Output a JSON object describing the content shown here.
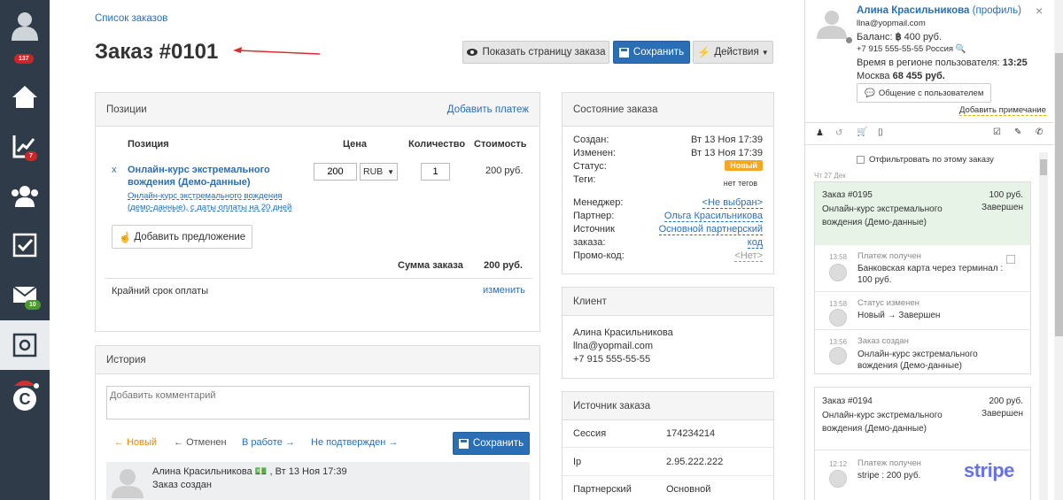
{
  "breadcrumb": "Список заказов",
  "page_title": "Заказ #0101",
  "toolbar": {
    "show_page": "Показать страницу заказа",
    "save": "Сохранить",
    "actions": "Действия"
  },
  "sidebar": {
    "badges": [
      "137",
      "7",
      "10"
    ]
  },
  "positions": {
    "title": "Позиции",
    "add_payment": "Добавить платеж",
    "headers": [
      "Позиция",
      "Цена",
      "Количество",
      "Стоимость"
    ],
    "remove": "x",
    "item_name": "Онлайн-курс экстремального вождения (Демо-данные)",
    "item_desc": "Онлайн-курс экстремального вождения (демо-данные), с даты оплаты на 20 дней",
    "price": "200",
    "currency": "RUB",
    "qty": "1",
    "cost": "200 руб.",
    "add_offer": "Добавить предложение",
    "sum_label": "Сумма заказа",
    "sum_value": "200 руб.",
    "deadline_label": "Крайний срок оплаты",
    "change": "изменить"
  },
  "history": {
    "title": "История",
    "placeholder": "Добавить комментарий",
    "statuses": [
      "Новый",
      "Отменен",
      "В работе",
      "Не подтвержден"
    ],
    "save": "Сохранить",
    "entry_author": "Алина Красильникова",
    "entry_time": ", Вт 13 Ноя 17:39",
    "entry_text": "Заказ создан"
  },
  "order_state": {
    "title": "Состояние заказа",
    "created_label": "Создан:",
    "created": "Вт 13 Ноя 17:39",
    "changed_label": "Изменен:",
    "changed": "Вт 13 Ноя 17:39",
    "status_label": "Статус:",
    "status": "Новый",
    "tags_label": "Теги:",
    "tags": "нет тегов",
    "manager_label": "Менеджер:",
    "manager": "<Не выбран>",
    "partner_label": "Партнер:",
    "partner": "Ольга Красильникова",
    "source_label": "Источник",
    "source": "Основной партнерский",
    "source_label2": "заказа:",
    "source2": "код",
    "promo_label": "Промо-код:",
    "promo": "<Нет>"
  },
  "client": {
    "title": "Клиент",
    "name": "Алина Красильникова",
    "email": "llna@yopmail.com",
    "phone": "+7 915 555-55-55"
  },
  "order_source": {
    "title": "Источник заказа",
    "session_label": "Сессия",
    "session": "174234214",
    "ip_label": "Ip",
    "ip": "2.95.222.222",
    "partner_label": "Партнерский",
    "partner": "Основной"
  },
  "user": {
    "name": "Алина Красильникова",
    "profile": "(профиль)",
    "email": "llna@yopmail.com",
    "balance_label": "Баланс:",
    "balance": "400 руб.",
    "phone": "+7 915 555-55-55 Россия",
    "region_time_label": "Время в регионе пользователя:",
    "region_time": "13:25",
    "moscow_label": "Москва",
    "moscow": "68 455 руб.",
    "chat_button": "Общение с пользователем",
    "add_note": "Добавить примечание"
  },
  "feed": {
    "filter": "Отфильтровать по этому заказу",
    "date": "Чт 27 Дек",
    "order1": {
      "id": "Заказ #0195",
      "price": "100 руб.",
      "name": "Онлайн-курс экстремального вождения (Демо-данные)",
      "status": "Завершен"
    },
    "events1": [
      {
        "time": "13:58",
        "title": "Платеж получен",
        "text": "Банковская карта через терминал : 100 руб."
      },
      {
        "time": "13:58",
        "title": "Статус изменен",
        "text": "Новый → Завершен"
      },
      {
        "time": "13:56",
        "title": "Заказ создан",
        "text": "Онлайн-курс экстремального вождения (Демо-данные)"
      }
    ],
    "order2": {
      "id": "Заказ #0194",
      "price": "200 руб.",
      "name": "Онлайн-курс экстремального вождения (Демо-данные)",
      "status": "Завершен"
    },
    "events2": [
      {
        "time": "12:12",
        "title": "Платеж получен",
        "text": "stripe : 200 руб.",
        "logo": "stripe"
      }
    ]
  },
  "colors": {
    "sidebar": "#2f3b48",
    "accent": "#2a6fb5",
    "badge_red": "#c62828",
    "badge_green": "#4a9a2f",
    "status_new": "#f5a623",
    "annotation_arrow": "#d32f2f"
  }
}
